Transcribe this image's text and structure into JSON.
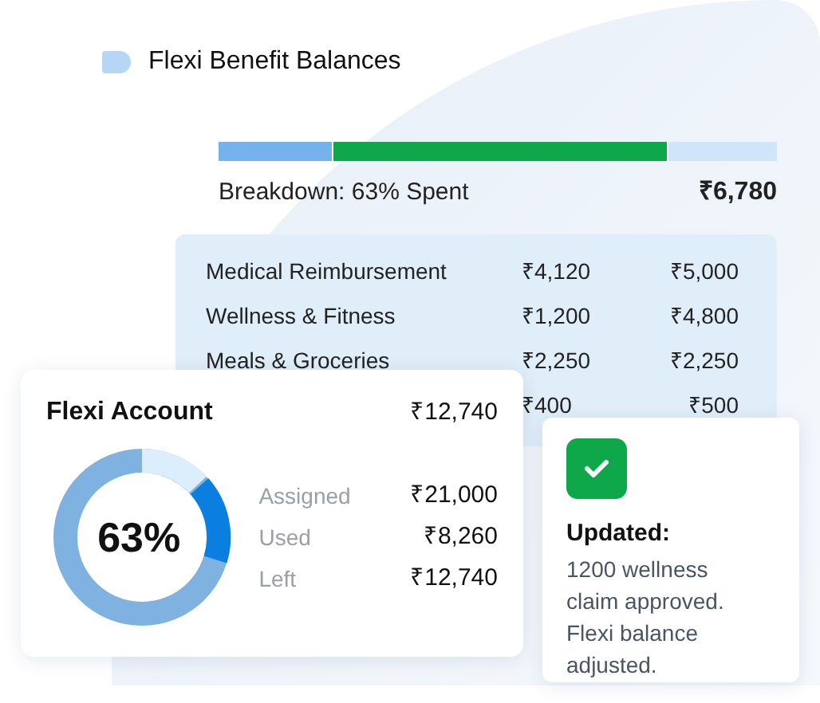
{
  "title": "Flexi Benefit Balances",
  "breakdown_bar": {
    "segments": [
      {
        "color": "#74b3ec"
      },
      {
        "color": "#0ea84a"
      },
      {
        "color": "#cfe5f8"
      }
    ]
  },
  "breakdown_label": "Breakdown: 63% Spent",
  "breakdown_amount": "₹6,780",
  "categories": [
    {
      "label": "Medical Reimbursement",
      "used": "₹4,120",
      "limit": "₹5,000"
    },
    {
      "label": "Wellness & Fitness",
      "used": "₹1,200",
      "limit": "₹4,800"
    },
    {
      "label": "Meals & Groceries",
      "used": "₹2,250",
      "limit": "₹2,250"
    },
    {
      "used": "₹400",
      "limit": "₹500"
    }
  ],
  "account_card": {
    "title": "Flexi Account",
    "amount": "₹12,740",
    "percent": "63%",
    "stats": [
      {
        "label": "Assigned",
        "value": "₹21,000"
      },
      {
        "label": "Used",
        "value": "₹8,260"
      },
      {
        "label": "Left",
        "value": "₹12,740"
      }
    ]
  },
  "notification": {
    "heading": "Updated:",
    "message": "1200 wellness claim approved. Flexi balance adjusted."
  }
}
